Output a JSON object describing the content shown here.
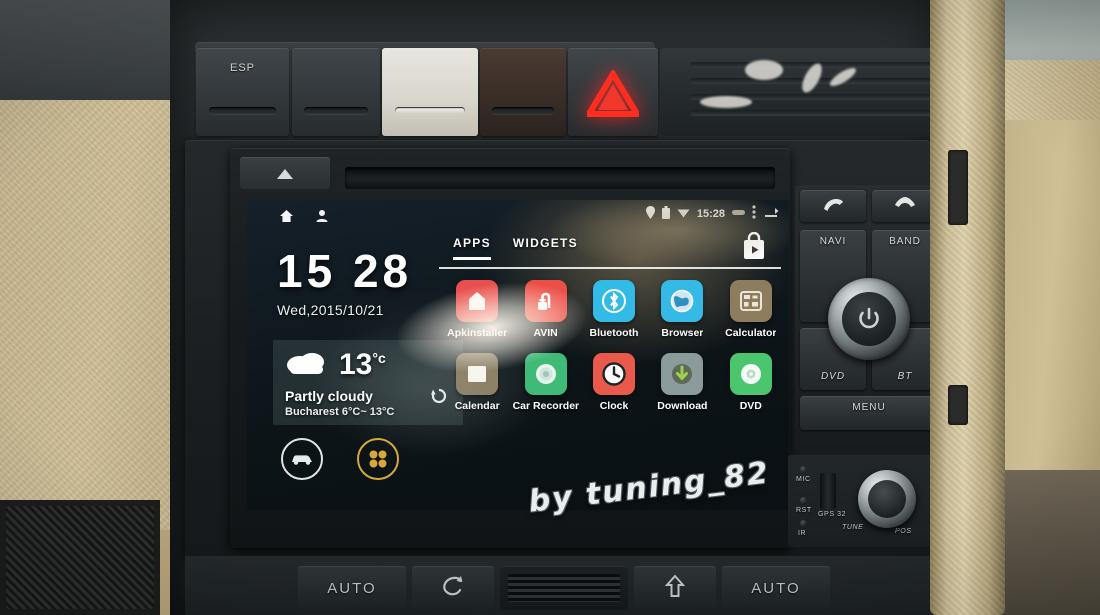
{
  "photo": {
    "watermark": "by tuning_82",
    "subject": "Audi A4 B7 dashboard with Android car head unit"
  },
  "head_unit": {
    "eject_icon": "eject-triangle-icon",
    "disc_slot": "cd-slot"
  },
  "screen": {
    "status_bar": {
      "home_icon": "home-icon",
      "person_icon": "person-icon",
      "location_icon": "location-pin-icon",
      "battery_icon": "battery-icon",
      "wifi_icon": "wifi-icon",
      "clock": "15:28",
      "sd_icon": "sd-card-icon",
      "overflow_icon": "overflow-menu-icon",
      "back_icon": "back-icon"
    },
    "clock_widget": {
      "time": "15 28",
      "date": "Wed,2015/10/21"
    },
    "weather_widget": {
      "condition_icon": "cloud-icon",
      "temperature": "13",
      "unit": "°c",
      "condition": "Partly cloudy",
      "range": "Bucharest 6°C~ 13°C",
      "refresh_icon": "refresh-icon"
    },
    "dock": [
      {
        "name": "car-mode-button",
        "icon": "car-icon",
        "color": "#dfe6e6"
      },
      {
        "name": "all-apps-button",
        "icon": "apps-grid-icon",
        "color": "#d8a93a"
      }
    ],
    "drawer": {
      "tabs": [
        {
          "label": "APPS",
          "active": true
        },
        {
          "label": "WIDGETS",
          "active": false
        }
      ],
      "store_icon": "play-store-bag-icon",
      "apps": [
        {
          "label": "Apkinstaller",
          "icon": "apk-installer-icon",
          "color": "#e8504f"
        },
        {
          "label": "AVIN",
          "icon": "av-input-icon",
          "color": "#ec4f47"
        },
        {
          "label": "Bluetooth",
          "icon": "bluetooth-icon",
          "color": "#33bbe8"
        },
        {
          "label": "Browser",
          "icon": "browser-globe-icon",
          "color": "#35b9e6"
        },
        {
          "label": "Calculator",
          "icon": "calculator-icon",
          "color": "#8d7d5e"
        },
        {
          "label": "Calendar",
          "icon": "calendar-icon",
          "color": "#8b7f63"
        },
        {
          "label": "Car Recorder",
          "icon": "camera-record-icon",
          "color": "#3fba77"
        },
        {
          "label": "Clock",
          "icon": "clock-icon",
          "color": "#ea5a4c"
        },
        {
          "label": "Download",
          "icon": "download-icon",
          "color": "#8b9a9b"
        },
        {
          "label": "DVD",
          "icon": "dvd-disc-icon",
          "color": "#4cc56f"
        }
      ]
    }
  },
  "dash_buttons": [
    {
      "label": "ESP",
      "name": "esp-button"
    },
    {
      "label": "",
      "name": "blank-button-1"
    },
    {
      "label": "",
      "name": "glare-button"
    },
    {
      "label": "",
      "name": "blank-button-2"
    },
    {
      "label": "",
      "name": "hazard-button",
      "icon": "hazard-triangle-icon",
      "color": "#ff2d20"
    }
  ],
  "controls": {
    "call": {
      "label": "",
      "icon": "phone-answer-icon"
    },
    "end": {
      "label": "",
      "icon": "phone-hangup-icon"
    },
    "navi": "NAVI",
    "band": "BAND",
    "dvd": "DVD",
    "bt": "BT",
    "menu": "MENU",
    "power_icon": "power-icon"
  },
  "small_controls": {
    "mic": "MIC",
    "rst": "RST",
    "ir": "IR",
    "gps": "GPS 32",
    "tune": "TUNE",
    "pos": "POS"
  },
  "climate": {
    "auto_left": "AUTO",
    "recirc_icon": "recirculation-icon",
    "vent": "center-vent",
    "defrost_icon": "airflow-up-icon",
    "auto_right": "AUTO"
  }
}
